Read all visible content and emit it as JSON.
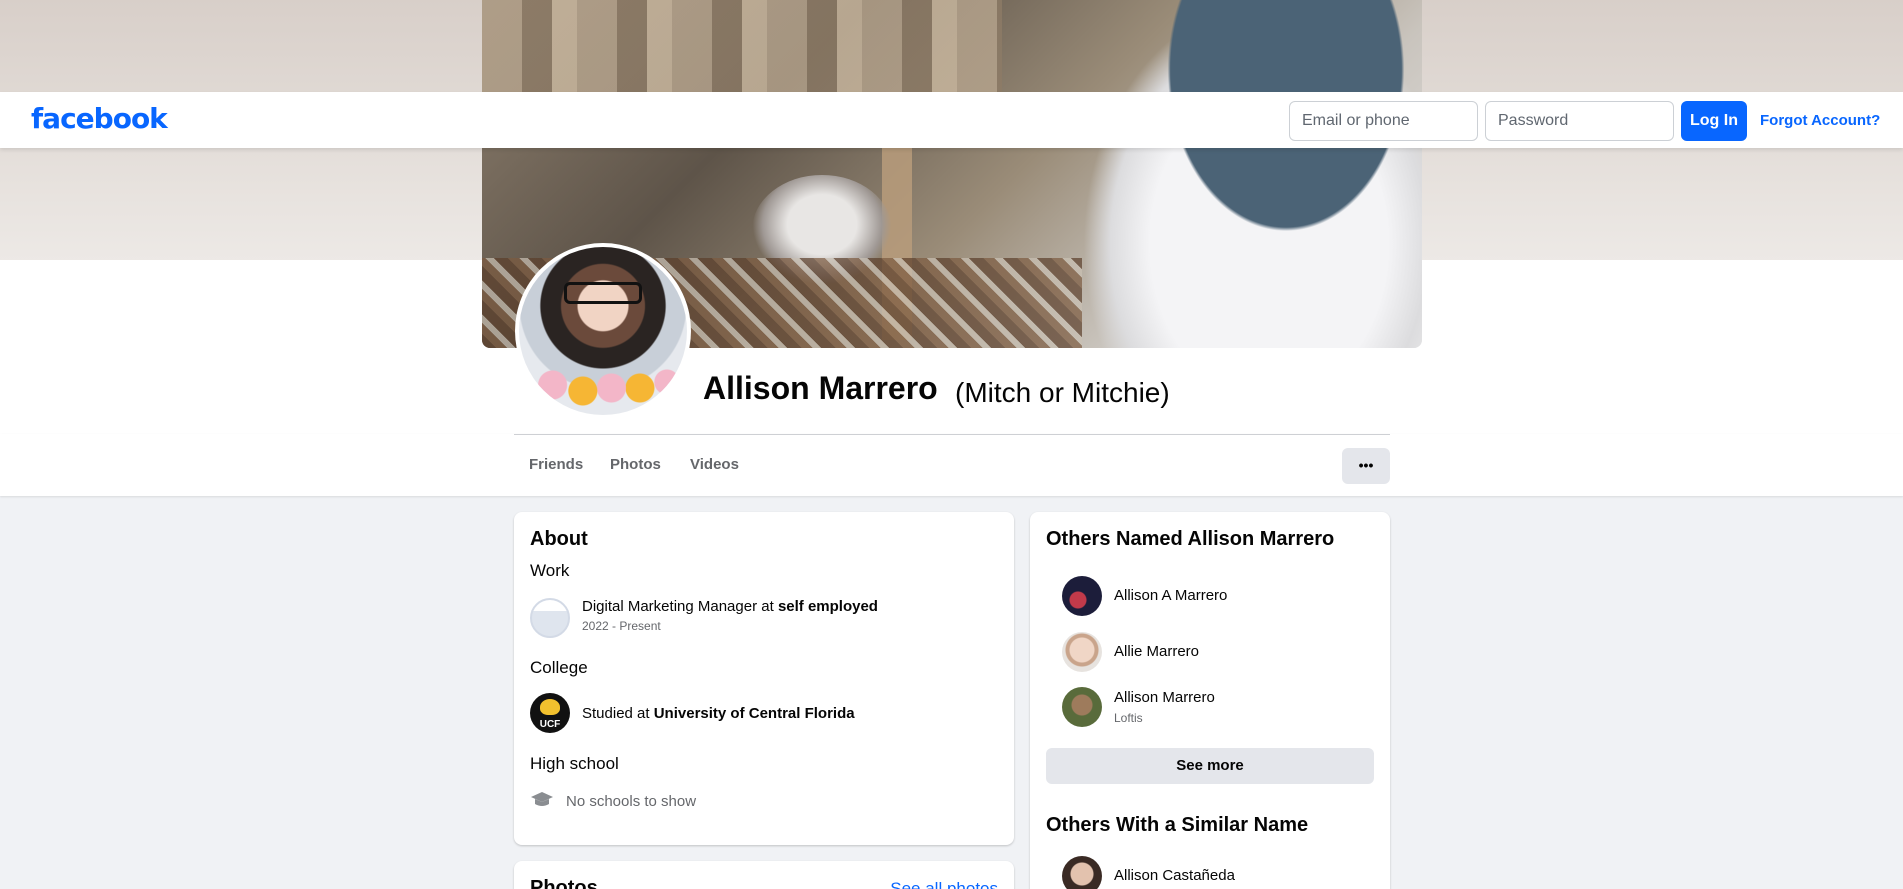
{
  "header": {
    "logo": "facebook",
    "email_placeholder": "Email or phone",
    "password_placeholder": "Password",
    "login_label": "Log In",
    "forgot_label": "Forgot Account?"
  },
  "profile": {
    "name": "Allison Marrero",
    "alt_name": "(Mitch or Mitchie)"
  },
  "tabs": [
    "Friends",
    "Photos",
    "Videos"
  ],
  "more_label": "•••",
  "about": {
    "title": "About",
    "work_heading": "Work",
    "work_prefix": "Digital Marketing Manager at ",
    "work_place": "self employed",
    "work_dates": "2022 - Present",
    "college_heading": "College",
    "college_prefix": "Studied at ",
    "college_name": "University of Central Florida",
    "college_logo": "UCF",
    "highschool_heading": "High school",
    "highschool_text": "No schools to show"
  },
  "photos": {
    "title": "Photos",
    "see_all": "See all photos"
  },
  "others_named": {
    "title": "Others Named Allison Marrero",
    "people": [
      {
        "name": "Allison A Marrero",
        "sub": ""
      },
      {
        "name": "Allie Marrero",
        "sub": ""
      },
      {
        "name": "Allison Marrero",
        "sub": "Loftis"
      }
    ],
    "see_more": "See more"
  },
  "similar": {
    "title": "Others With a Similar Name",
    "people": [
      {
        "name": "Allison Castañeda"
      }
    ]
  },
  "colors": {
    "brand": "#0866ff",
    "page_bg": "#f0f2f5"
  }
}
